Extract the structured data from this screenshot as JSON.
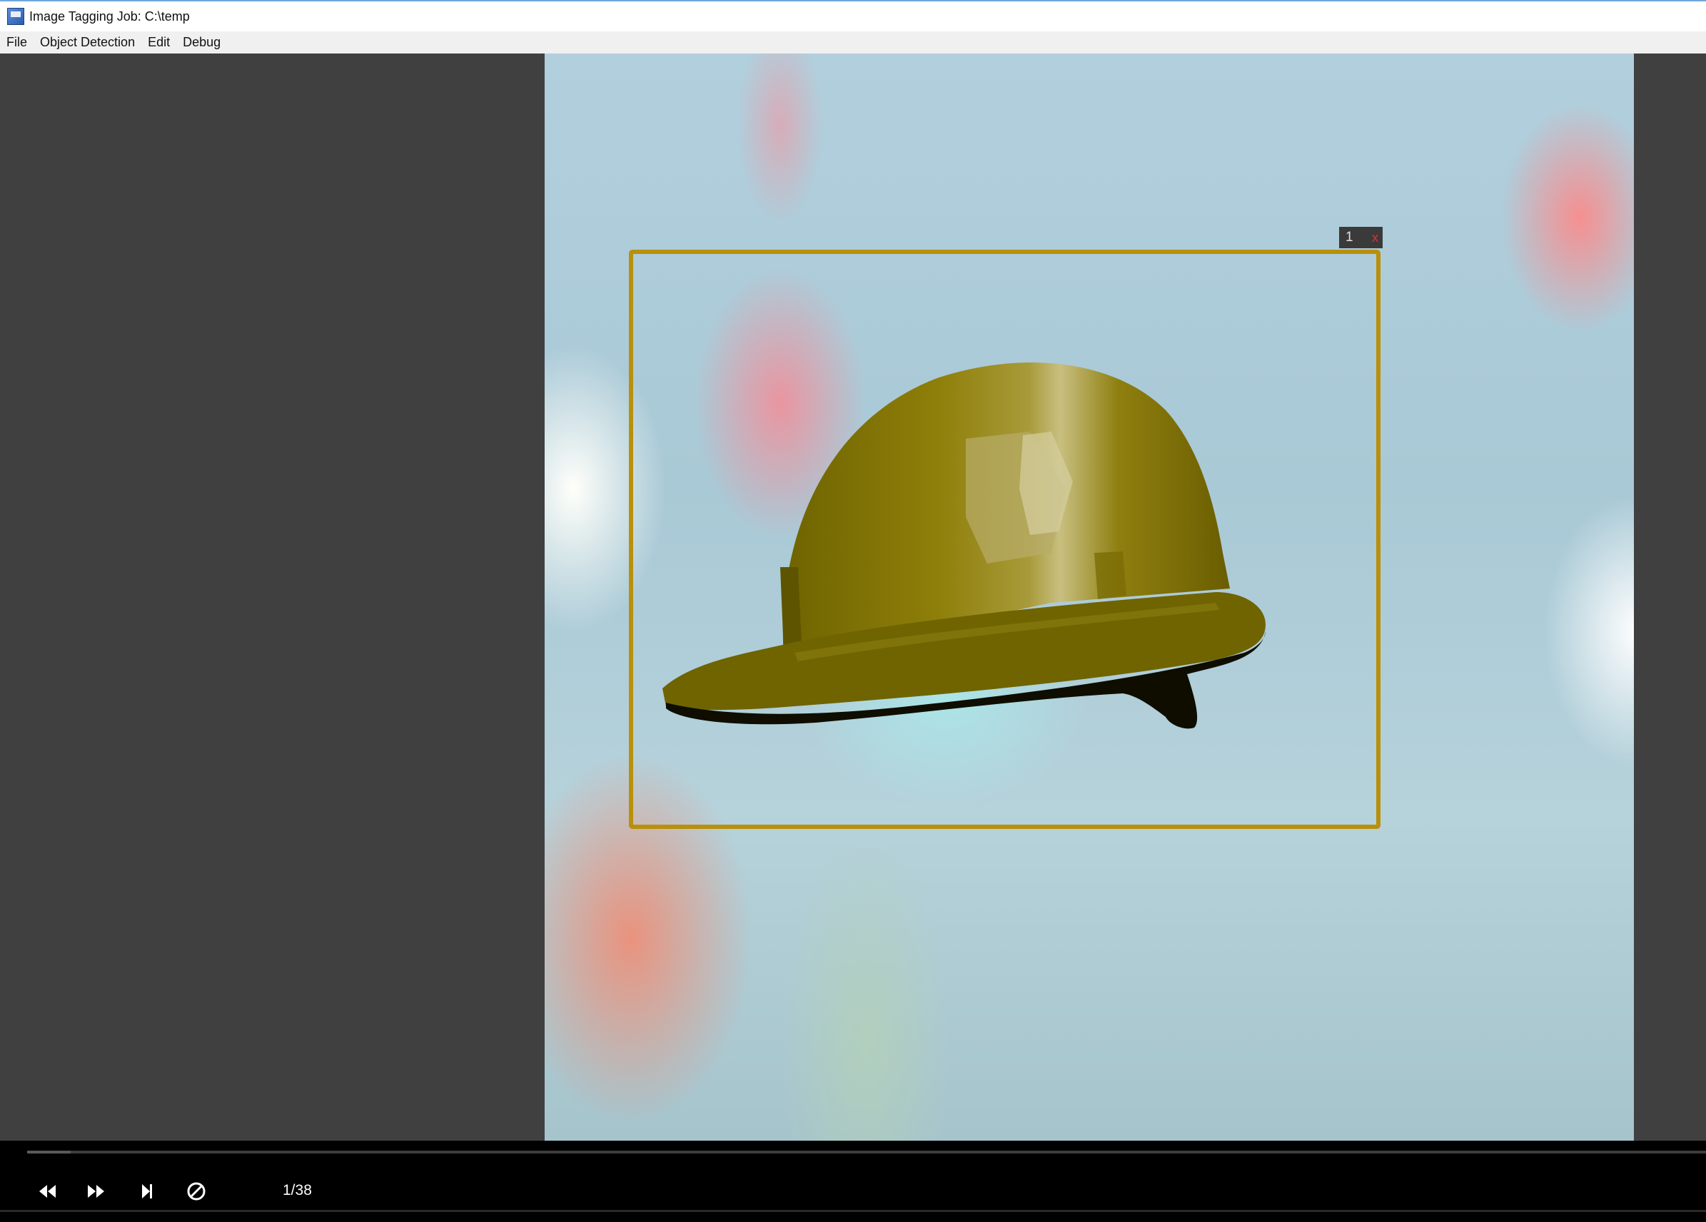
{
  "window": {
    "title": "Image Tagging Job: C:\\temp"
  },
  "menu": {
    "items": [
      {
        "label": "File"
      },
      {
        "label": "Object Detection"
      },
      {
        "label": "Edit"
      },
      {
        "label": "Debug"
      }
    ]
  },
  "canvas": {
    "subject": "hard hat on blurred bokeh background",
    "annotations": [
      {
        "id_label": "1",
        "remove_label": "x",
        "color": "#b8900c"
      }
    ]
  },
  "controls": {
    "buttons": [
      {
        "icon": "rewind-icon",
        "name": "previous-button"
      },
      {
        "icon": "fast-forward-icon",
        "name": "next-button"
      },
      {
        "icon": "skip-to-end-icon",
        "name": "skip-button"
      },
      {
        "icon": "block-icon",
        "name": "mark-empty-button"
      }
    ],
    "counter": "1/38",
    "progress_fraction": 0.026
  },
  "colors": {
    "workspace_bg": "#404040",
    "control_bar_bg": "#000000",
    "bbox_color": "#b8900c",
    "close_color": "#e03030"
  }
}
